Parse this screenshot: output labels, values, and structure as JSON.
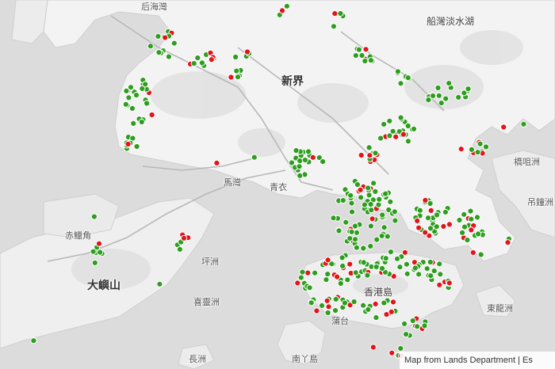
{
  "map": {
    "place_labels": {
      "hau_hoi_wan": "后海灣",
      "chuen_wan_tam": "船灣淡水湖",
      "new_territories": "新界",
      "kiu_tsui": "橋咀洲",
      "tsing_yi": "青衣",
      "ma_wan": "馬灣",
      "chek_lap_kok": "赤鱲角",
      "peng_chau": "坪洲",
      "lantau": "大嶼山",
      "hei_ling_chau": "喜靈洲",
      "hk_island": "香港島",
      "tung_lung": "東龍洲",
      "lamma": "南丫島",
      "po_toi": "蒲台",
      "cheung_chau": "長洲",
      "tap_mun": "吊鐘洲"
    },
    "attribution": "Map from Lands Department | Es",
    "legend_colors": {
      "marker_green": "#2e9e1f",
      "marker_red": "#e3141b"
    }
  }
}
